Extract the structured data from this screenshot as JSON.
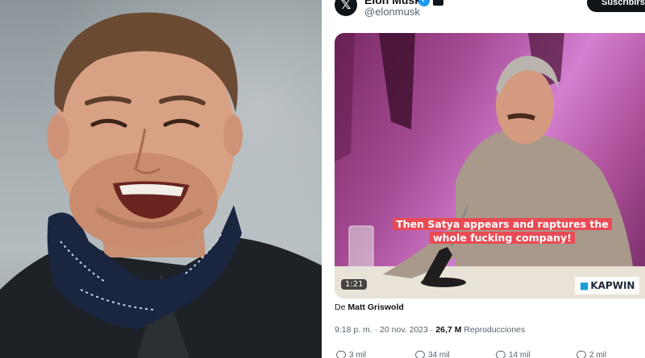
{
  "tweet": {
    "author_name": "Elon Musk",
    "handle": "@elonmusk",
    "subscribe_label": "Suscribirse",
    "video": {
      "caption": "Then Satya appears and raptures the whole fucking company!",
      "duration": "1:21",
      "watermark": "KAPWIN"
    },
    "from_prefix": "De",
    "from_author": "Matt Griswold",
    "time": "9:18 p. m.",
    "separator": "·",
    "date": "20 nov. 2023",
    "views_count": "26,7 M",
    "views_label": "Reproducciones",
    "actions": [
      {
        "name": "reply",
        "icon": "reply-icon",
        "label": "3 mil"
      },
      {
        "name": "repost",
        "icon": "repost-icon",
        "label": "34 mil"
      },
      {
        "name": "like",
        "icon": "heart-icon",
        "label": "14 mil"
      },
      {
        "name": "bookmark",
        "icon": "bookmark-icon",
        "label": "2 mil"
      }
    ]
  },
  "colors": {
    "verified": "#1d9bf0",
    "caption_bg": "#e94b55",
    "subscribe_bg": "#0f1419",
    "secondary_text": "#536471"
  }
}
